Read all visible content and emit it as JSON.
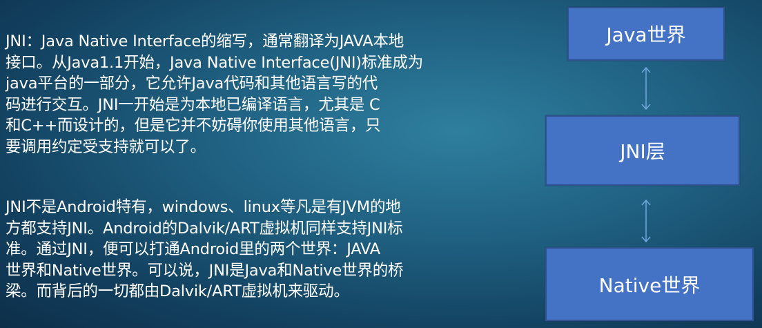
{
  "text": {
    "paragraph1": [
      "JNI：Java Native Interface的缩写，通常翻译为JAVA本地",
      "接口。从Java1.1开始，Java Native Interface(JNI)标准成为",
      "java平台的一部分，它允许Java代码和其他语言写的代",
      "码进行交互。JNI一开始是为本地已编译语言，尤其是 C",
      "和C++而设计的，但是它并不妨碍你使用其他语言，只",
      "要调用约定受支持就可以了。"
    ],
    "paragraph2": [
      "JNI不是Android特有，windows、linux等凡是有JVM的地",
      "方都支持JNI。Android的Dalvik/ART虚拟机同样支持JNI标",
      "准。通过JNI，便可以打通Android里的两个世界：JAVA",
      "世界和Native世界。可以说，JNI是Java和Native世界的桥",
      "梁。而背后的一切都由Dalvik/ART虚拟机来驱动。"
    ]
  },
  "diagram": {
    "java_box": "Java世界",
    "jni_box": "JNI层",
    "native_box": "Native世界"
  },
  "colors": {
    "box_fill": "#4472c4",
    "box_border": "#2f528f",
    "arrow": "#6fa8dc",
    "text": "#ffffff"
  }
}
